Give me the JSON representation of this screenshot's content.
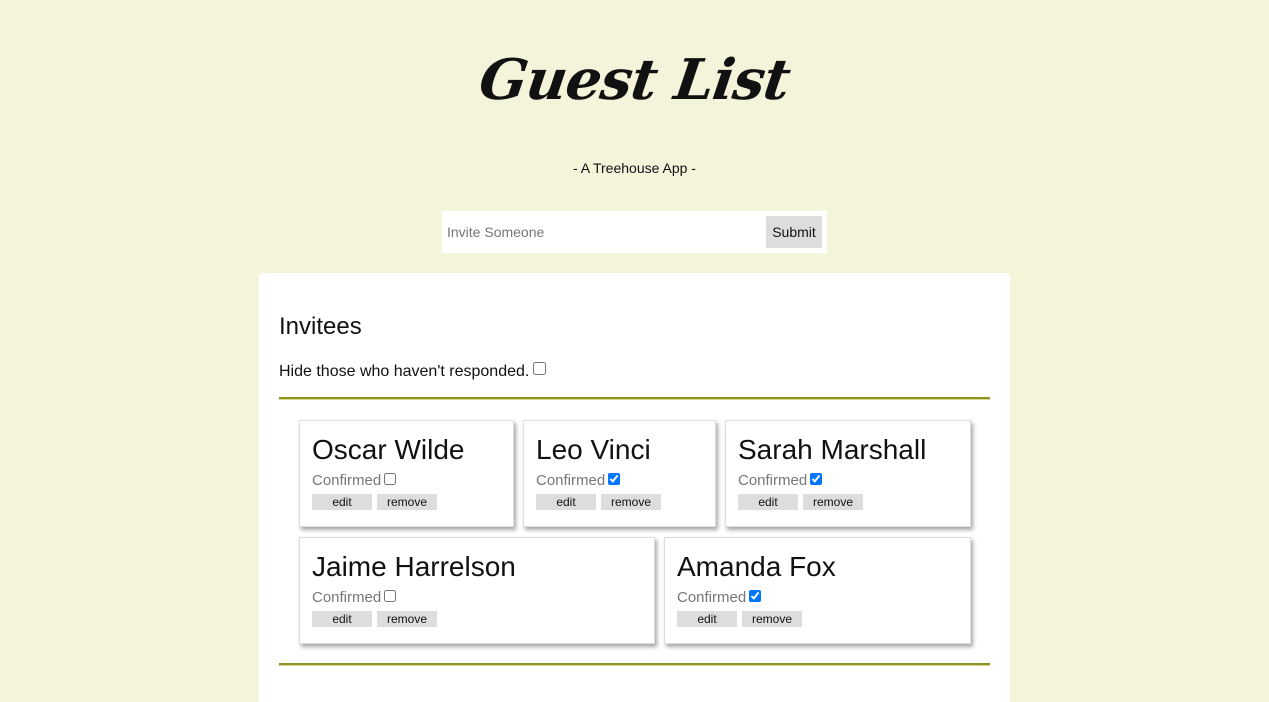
{
  "header": {
    "title": "Guest List",
    "subtitle": "- A Treehouse App -"
  },
  "invite_form": {
    "placeholder": "Invite Someone",
    "value": "",
    "submit_label": "Submit"
  },
  "main": {
    "section_title": "Invitees",
    "filter_label": "Hide those who haven't responded.",
    "filter_checked": false
  },
  "invitees": [
    {
      "name": "Oscar Wilde",
      "confirmed_label": "Confirmed",
      "confirmed": false,
      "edit_label": "edit",
      "remove_label": "remove"
    },
    {
      "name": "Leo Vinci",
      "confirmed_label": "Confirmed",
      "confirmed": true,
      "edit_label": "edit",
      "remove_label": "remove"
    },
    {
      "name": "Sarah Marshall",
      "confirmed_label": "Confirmed",
      "confirmed": true,
      "edit_label": "edit",
      "remove_label": "remove"
    },
    {
      "name": "Jaime Harrelson",
      "confirmed_label": "Confirmed",
      "confirmed": false,
      "edit_label": "edit",
      "remove_label": "remove"
    },
    {
      "name": "Amanda Fox",
      "confirmed_label": "Confirmed",
      "confirmed": true,
      "edit_label": "edit",
      "remove_label": "remove"
    }
  ],
  "colors": {
    "background": "#f4f4da",
    "panel": "#ffffff",
    "rule": "#8f8f28",
    "button": "#dddddd",
    "muted_text": "#777777"
  }
}
